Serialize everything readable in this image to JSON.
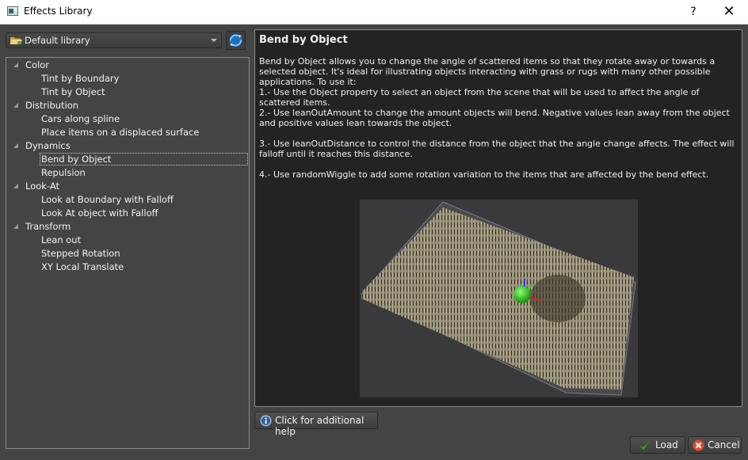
{
  "window": {
    "title": "Effects Library",
    "help_label": "?",
    "close_label": "✕"
  },
  "library": {
    "selected": "Default library",
    "icon": "folder-icon",
    "refresh_icon": "refresh-icon"
  },
  "tree": {
    "categories": [
      {
        "label": "Color",
        "items": [
          "Tint by Boundary",
          "Tint by Object"
        ]
      },
      {
        "label": "Distribution",
        "items": [
          "Cars along spline",
          "Place items on a displaced surface"
        ]
      },
      {
        "label": "Dynamics",
        "items": [
          "Bend by Object",
          "Repulsion"
        ]
      },
      {
        "label": "Look-At",
        "items": [
          "Look at Boundary with Falloff",
          "Look At object with Falloff"
        ]
      },
      {
        "label": "Transform",
        "items": [
          "Lean out",
          "Stepped Rotation",
          "XY Local Translate"
        ]
      }
    ],
    "selected_item": "Bend by Object"
  },
  "description": {
    "title": "Bend by Object",
    "paragraphs": [
      "Bend by Object allows you to change the angle of scattered items so that they rotate away or towards a selected object. It's ideal for illustrating objects interacting with grass or rugs with many other possible applications. To use it:",
      "1.- Use the Object property to select an object from the scene that will be used to affect the angle of scattered items.",
      "2.- Use leanOutAmount to change the amount objects will bend. Negative values lean away from the object and positive values lean towards the object.",
      "3.- Use leanOutDistance to control the distance from the object that the angle change affects. The effect will falloff until it reaches this distance.",
      "4.- Use randomWiggle to add some rotation variation to the items that are affected by the bend effect."
    ],
    "preview_alt": "Grass field bending around a green sphere"
  },
  "buttons": {
    "help": "Click for additional help",
    "load": "Load",
    "cancel": "Cancel"
  }
}
